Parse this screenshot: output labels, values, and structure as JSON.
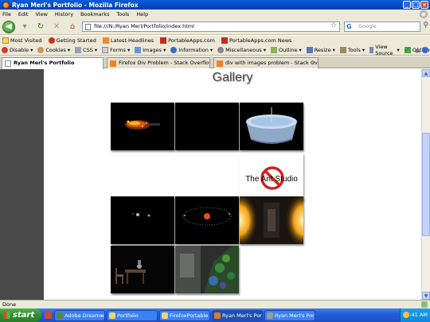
{
  "window": {
    "title": "Ryan Merl's Portfolio - Mozilla Firefox"
  },
  "menu": [
    "File",
    "Edit",
    "View",
    "History",
    "Bookmarks",
    "Tools",
    "Help"
  ],
  "nav": {
    "back": "◀",
    "dropdown": "▾",
    "reload": "↻",
    "stop": "✕",
    "home": "⌂",
    "url": "file:///N:/Ryan Merl/Portfolio/index.html",
    "search_placeholder": "Google",
    "search_engine_logo": "G"
  },
  "bookmarks": [
    {
      "label": "Most Visited",
      "icon": "folder-icon"
    },
    {
      "label": "Getting Started",
      "icon": "firefox-icon"
    },
    {
      "label": "Latest Headlines",
      "icon": "rss-icon"
    },
    {
      "label": "PortableApps.com",
      "icon": "portableapps-icon"
    },
    {
      "label": "PortableApps.com News",
      "icon": "portableapps-icon"
    }
  ],
  "devbar": [
    {
      "label": "Disable",
      "icon": "disable-icon",
      "cls": "dis"
    },
    {
      "label": "Cookies",
      "icon": "cookie-icon",
      "cls": "cookie"
    },
    {
      "label": "CSS",
      "icon": "css-icon",
      "cls": "css"
    },
    {
      "label": "Forms",
      "icon": "forms-icon",
      "cls": "forms"
    },
    {
      "label": "Images",
      "icon": "images-icon",
      "cls": "img"
    },
    {
      "label": "Information",
      "icon": "information-icon",
      "cls": "info"
    },
    {
      "label": "Miscellaneous",
      "icon": "miscellaneous-icon",
      "cls": "misc"
    },
    {
      "label": "Outline",
      "icon": "outline-icon",
      "cls": "outline"
    },
    {
      "label": "Resize",
      "icon": "resize-icon",
      "cls": "resize"
    },
    {
      "label": "Tools",
      "icon": "tools-icon",
      "cls": "tools"
    },
    {
      "label": "View Source",
      "icon": "view-source-icon",
      "cls": "vs"
    },
    {
      "label": "Options",
      "icon": "options-icon",
      "cls": "opt"
    }
  ],
  "tabs": [
    {
      "label": "Ryan Merl's Portfolio",
      "active": true
    },
    {
      "label": "Firefox Div Problem - Stack Overflow",
      "active": false
    },
    {
      "label": "div with images problem - Stack Overflow",
      "active": false
    }
  ],
  "page": {
    "heading": "Gallery",
    "ant_studio_text": "The Ant Studio",
    "images": [
      "fire-particles-image",
      "water-bowl-image",
      "blank",
      "blank",
      "blank",
      "ant-studio-logo-image",
      "small-objects-image",
      "orbit-image",
      "glowing-corridor-image",
      "chair-room-image",
      "green-trees-image"
    ]
  },
  "status": {
    "text": "Done"
  },
  "taskbar": {
    "start": "start",
    "tasks": [
      {
        "label": "Adobe Dreamweav...",
        "color": "#5a8a3a"
      },
      {
        "label": "Portfolio",
        "color": "#f3d46b"
      },
      {
        "label": "FirefoxPortable",
        "color": "#f3d46b"
      },
      {
        "label": "Ryan Merl's Portfolio...",
        "color": "#e07a2a"
      },
      {
        "label": "Ryan Merl's Portfo...",
        "color": "#9a9a9a"
      }
    ],
    "clock": "6:41 AM"
  }
}
